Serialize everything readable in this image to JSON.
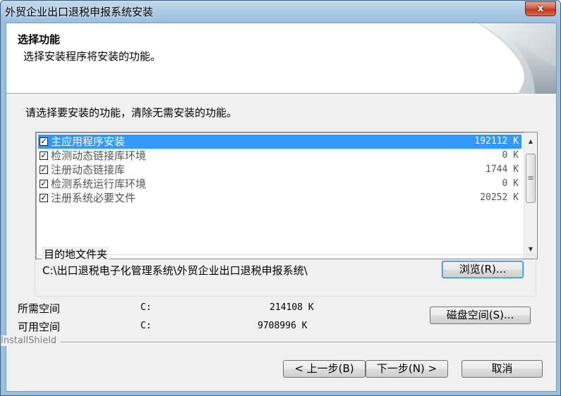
{
  "window": {
    "title": "外贸企业出口退税申报系统安装",
    "close_glyph": "x"
  },
  "header": {
    "title": "选择功能",
    "subtitle": "选择安装程序将安装的功能。"
  },
  "instruction": "请选择要安装的功能，清除无需安装的功能。",
  "features": [
    {
      "label": "主应用程序安装",
      "size": "192112 K",
      "checked": true,
      "selected": true
    },
    {
      "label": "检测动态链接库环境",
      "size": "0 K",
      "checked": true,
      "selected": false
    },
    {
      "label": "注册动态链接库",
      "size": "1744 K",
      "checked": true,
      "selected": false
    },
    {
      "label": "检测系统运行库环境",
      "size": "0 K",
      "checked": true,
      "selected": false
    },
    {
      "label": "注册系统必要文件",
      "size": "20252 K",
      "checked": true,
      "selected": false
    }
  ],
  "checkmark": "✓",
  "scrollbar": {
    "up": "▲",
    "down": "▼",
    "grip": "≡"
  },
  "destination": {
    "group_label": "目的地文件夹",
    "path": "C:\\出口退税电子化管理系统\\外贸企业出口退税申报系统\\",
    "browse_label": "浏览(R)..."
  },
  "space": {
    "required_label": "所需空间",
    "required_drive": "C:",
    "required_value": "214108 K",
    "available_label": "可用空间",
    "available_drive": "C:",
    "available_value": "9708996 K",
    "disk_button": "磁盘空间(S)..."
  },
  "brand": "InstallShield",
  "buttons": {
    "back": "< 上一步(B)",
    "next": "下一步(N) >",
    "cancel": "取消"
  }
}
